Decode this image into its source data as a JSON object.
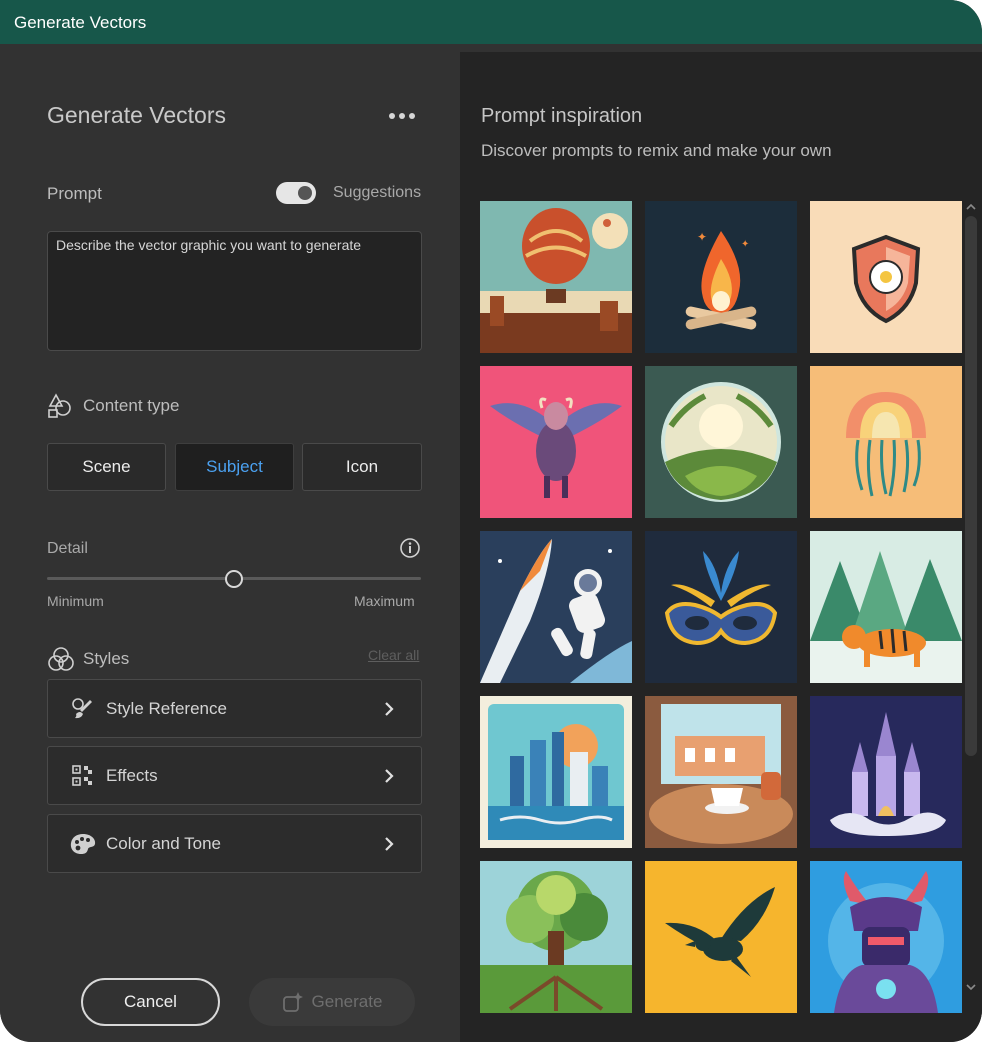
{
  "window": {
    "title": "Generate Vectors"
  },
  "panel": {
    "title": "Generate Vectors",
    "prompt_label": "Prompt",
    "suggestions_label": "Suggestions",
    "suggestions_on": true,
    "prompt_placeholder": "Describe the vector graphic you want to generate",
    "content_type": {
      "label": "Content type",
      "options": [
        "Scene",
        "Subject",
        "Icon"
      ],
      "selected": "Subject"
    },
    "detail": {
      "label": "Detail",
      "min_label": "Minimum",
      "max_label": "Maximum",
      "value": 0.5
    },
    "styles": {
      "label": "Styles",
      "clear_all": "Clear all",
      "items": [
        "Style Reference",
        "Effects",
        "Color and Tone"
      ]
    },
    "cancel_label": "Cancel",
    "generate_label": "Generate"
  },
  "inspiration": {
    "title": "Prompt inspiration",
    "subtitle": "Discover prompts to remix and make your own",
    "tiles": [
      {
        "name": "tile-hot-air-balloon",
        "icon": "hot-air-balloon-icon",
        "bg": "#e9d9b4"
      },
      {
        "name": "tile-campfire",
        "icon": "campfire-icon",
        "bg": "#1c2d3b"
      },
      {
        "name": "tile-shield-flower",
        "icon": "shield-flower-icon",
        "bg": "#f9dcb8"
      },
      {
        "name": "tile-winged-bull",
        "icon": "winged-bull-icon",
        "bg": "#f0547a"
      },
      {
        "name": "tile-terrarium-globe",
        "icon": "globe-icon",
        "bg": "#3b5a52"
      },
      {
        "name": "tile-jellyfish",
        "icon": "jellyfish-icon",
        "bg": "#f6bd78"
      },
      {
        "name": "tile-astronaut-rocket",
        "icon": "astronaut-icon",
        "bg": "#2a3f5c"
      },
      {
        "name": "tile-carnival-mask",
        "icon": "mask-icon",
        "bg": "#1f2b3d"
      },
      {
        "name": "tile-tiger-forest",
        "icon": "tiger-icon",
        "bg": "#d8ece4"
      },
      {
        "name": "tile-city-skyline",
        "icon": "city-icon",
        "bg": "#f3eedd"
      },
      {
        "name": "tile-cafe-table",
        "icon": "coffee-icon",
        "bg": "#8b5b3f"
      },
      {
        "name": "tile-fantasy-castle",
        "icon": "castle-icon",
        "bg": "#27295c"
      },
      {
        "name": "tile-tree-roots",
        "icon": "tree-icon",
        "bg": "#9dd3d9"
      },
      {
        "name": "tile-bird-silhouette",
        "icon": "bird-icon",
        "bg": "#f6b52d"
      },
      {
        "name": "tile-samurai-robot",
        "icon": "samurai-icon",
        "bg": "#2f9de0"
      }
    ]
  }
}
